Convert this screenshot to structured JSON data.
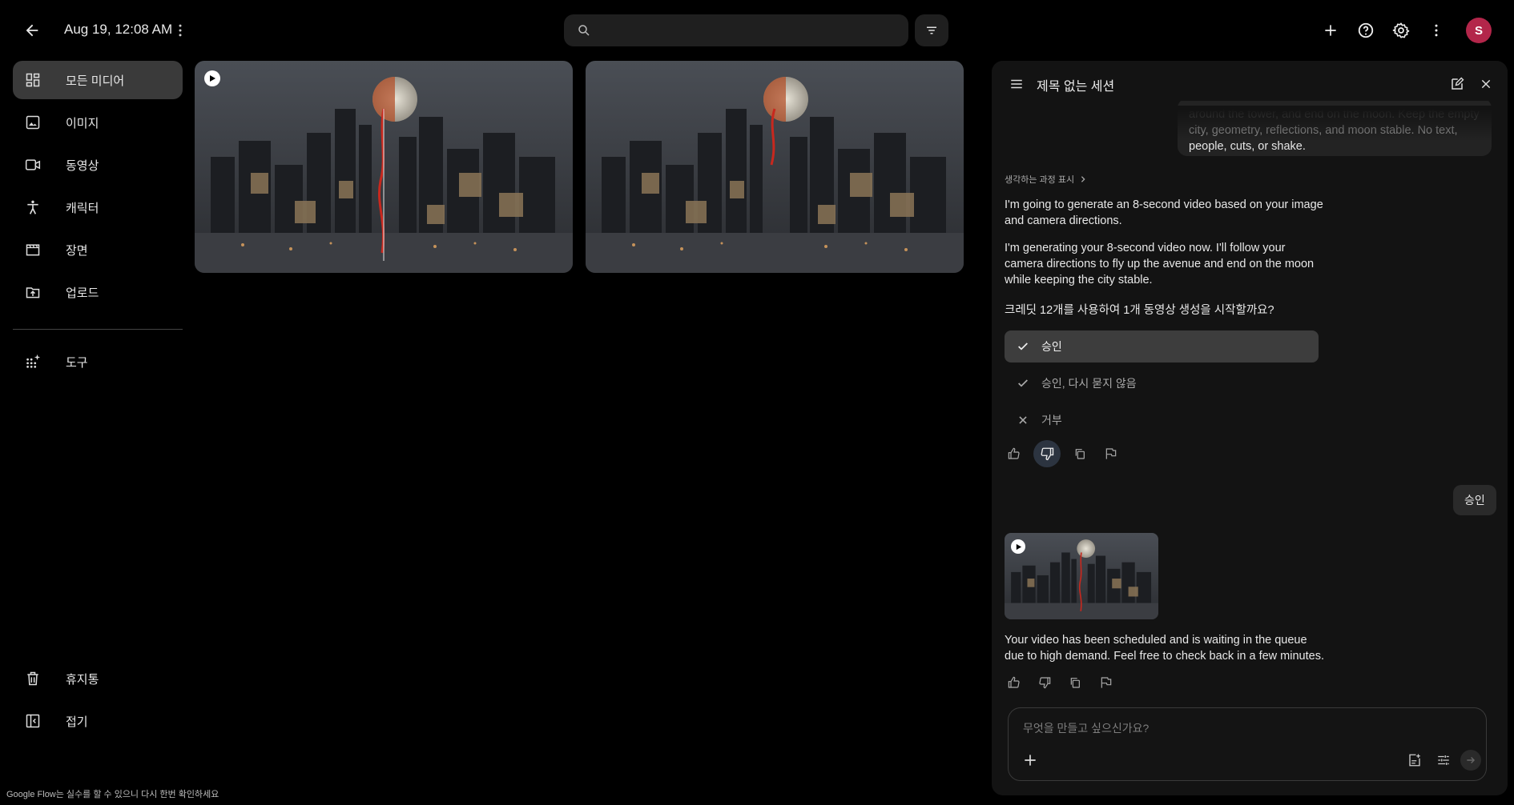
{
  "header": {
    "date": "Aug 19, 12:08 AM",
    "search_placeholder": "",
    "avatar_letter": "S"
  },
  "sidebar": {
    "items": [
      {
        "label": "모든 미디어",
        "icon": "grid-icon",
        "active": true
      },
      {
        "label": "이미지",
        "icon": "image-icon"
      },
      {
        "label": "동영상",
        "icon": "video-icon"
      },
      {
        "label": "캐릭터",
        "icon": "person-icon"
      },
      {
        "label": "장면",
        "icon": "scene-icon"
      },
      {
        "label": "업로드",
        "icon": "upload-icon"
      }
    ],
    "tools_label": "도구",
    "bottom": [
      {
        "label": "휴지통",
        "icon": "trash-icon"
      },
      {
        "label": "접기",
        "icon": "collapse-icon"
      }
    ]
  },
  "footer_note": "Google Flow는 실수를 할 수 있으니 다시 한번 확인하세요",
  "chat": {
    "title": "제목 없는 세션",
    "user_prompt_tail_faded": "around the tower, and end on the moon. Keep the empty",
    "user_prompt_tail_2": "city, geometry, reflections, and moon stable. No text,",
    "user_prompt_tail_3": "people, cuts, or shake.",
    "thinking_label": "생각하는 과정 표시",
    "msg1": "I'm going to generate an 8-second video based on your image and camera directions.",
    "msg2": "I'm generating your 8-second video now. I'll follow your camera directions to fly up the avenue and end on the moon while keeping the city stable.",
    "msg3": "크레딧 12개를 사용하여 1개 동영상 생성을 시작할까요?",
    "options": [
      {
        "label": "승인",
        "icon": "check-icon",
        "selected": true
      },
      {
        "label": "승인, 다시 묻지 않음",
        "icon": "check-icon"
      },
      {
        "label": "거부",
        "icon": "close-icon"
      }
    ],
    "user_reply": "승인",
    "final_msg": "Your video has been scheduled and is waiting in the queue due to high demand. Feel free to check back in a few minutes.",
    "composer_placeholder": "무엇을 만들고 싶으신가요?"
  }
}
